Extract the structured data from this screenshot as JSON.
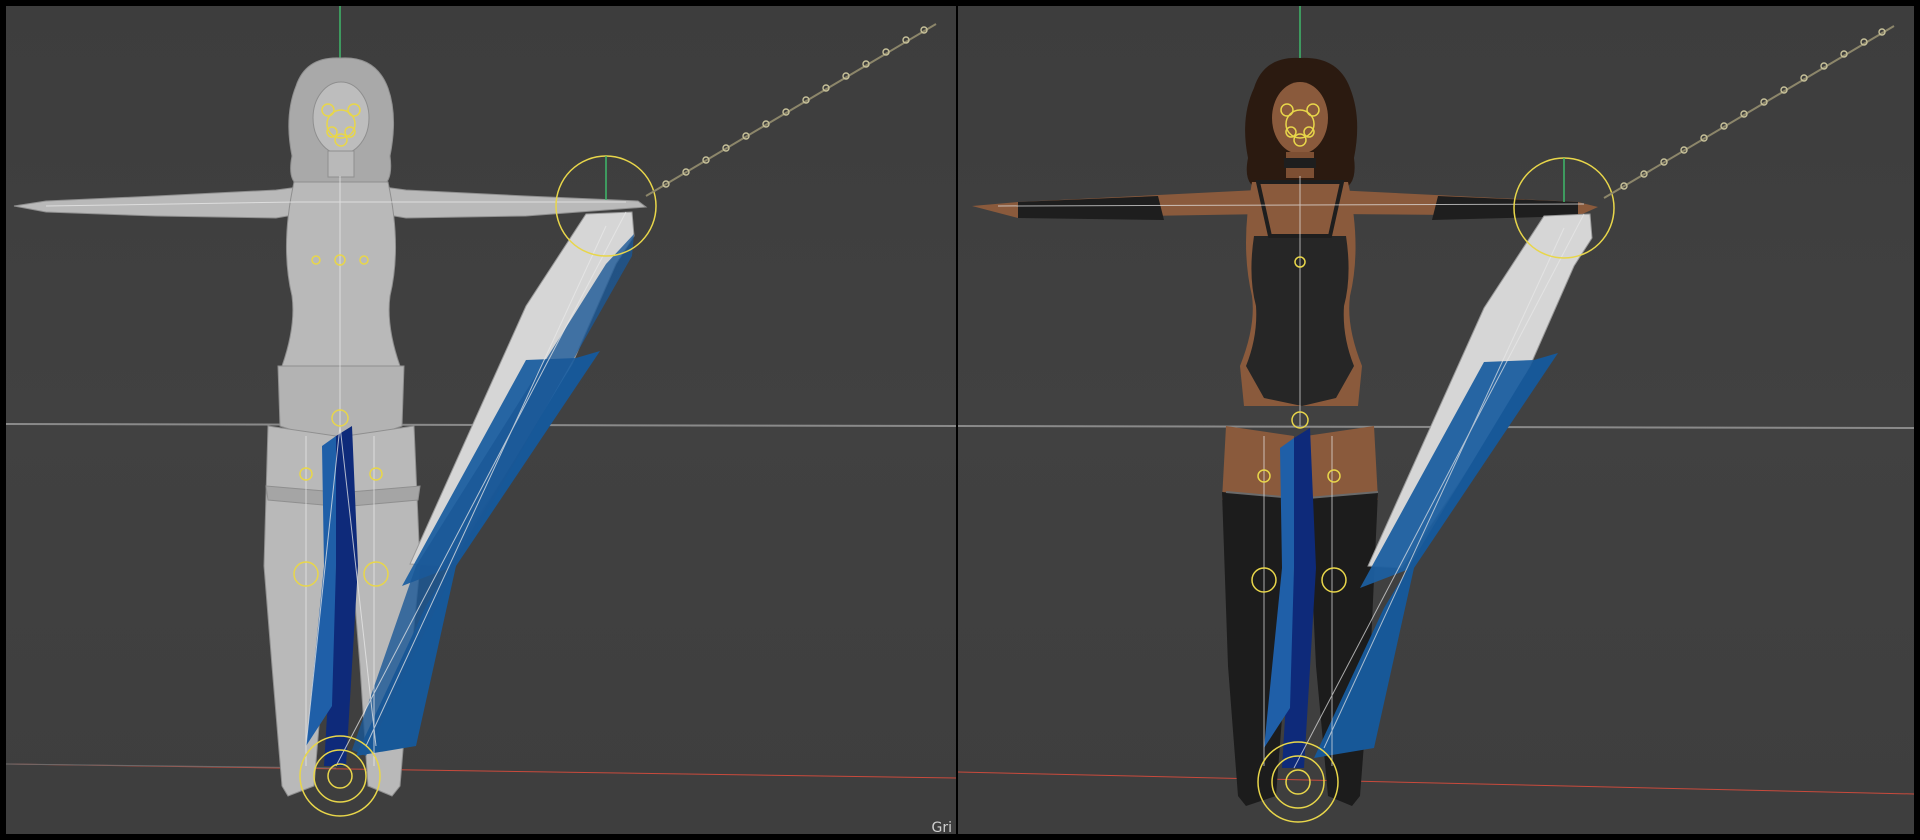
{
  "viewports": [
    {
      "id": "left",
      "shading": "untextured",
      "corner_label": "Gri"
    },
    {
      "id": "right",
      "shading": "textured",
      "corner_label": ""
    }
  ],
  "colors": {
    "background": "#404040",
    "divider": "#000000",
    "horizon_line": "#8a8a8a",
    "x_axis": "#c84a3c",
    "y_axis": "#3fb86a",
    "rig_control": "#e8d64a",
    "bone_highlight": "#1c5fa0",
    "bone_dark": "#0e2a7a",
    "bone_light": "#d8d8d8",
    "figure_grey": "#b9b9b9",
    "figure_skin": "#8a5a3c",
    "costume_black": "#1e1e1e"
  },
  "icons": {
    "pivot": "rig-pivot-circle-icon",
    "chain": "ik-chain-icon"
  }
}
